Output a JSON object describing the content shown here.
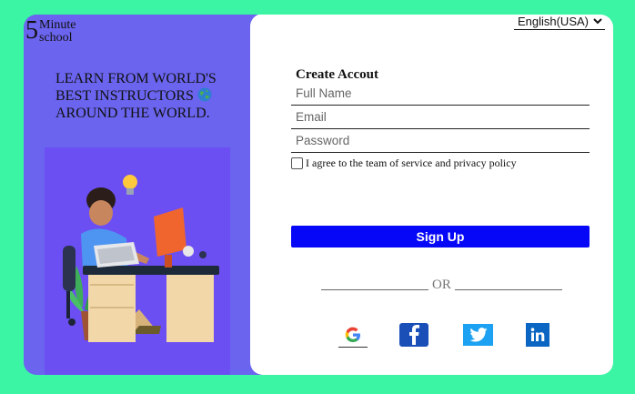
{
  "logo": {
    "digit": "5",
    "line1": "Minute",
    "line2": "school"
  },
  "hero": {
    "line1": "LEARN FROM WORLD'S",
    "line2": "BEST INSTRUCTORS",
    "line3": "AROUND THE WORLD."
  },
  "language": {
    "selected": "English(USA)"
  },
  "form": {
    "title": "Create Accout",
    "full_name_placeholder": "Full Name",
    "email_placeholder": "Email",
    "password_placeholder": "Password",
    "agree_text": "I agree to the team of service and privacy policy",
    "signup_label": "Sign Up",
    "or_text": "OR"
  },
  "social": [
    {
      "icon": "google-icon"
    },
    {
      "icon": "facebook-icon",
      "color": "#1b4fb8"
    },
    {
      "icon": "twitter-icon",
      "color": "#1da1f2"
    },
    {
      "icon": "linkedin-icon",
      "color": "#0a66c2"
    }
  ],
  "colors": {
    "background": "#3cf5a4",
    "left_panel": "#6a64ee",
    "illustration_bg": "#6c4ff3",
    "signup": "#0707f7"
  }
}
